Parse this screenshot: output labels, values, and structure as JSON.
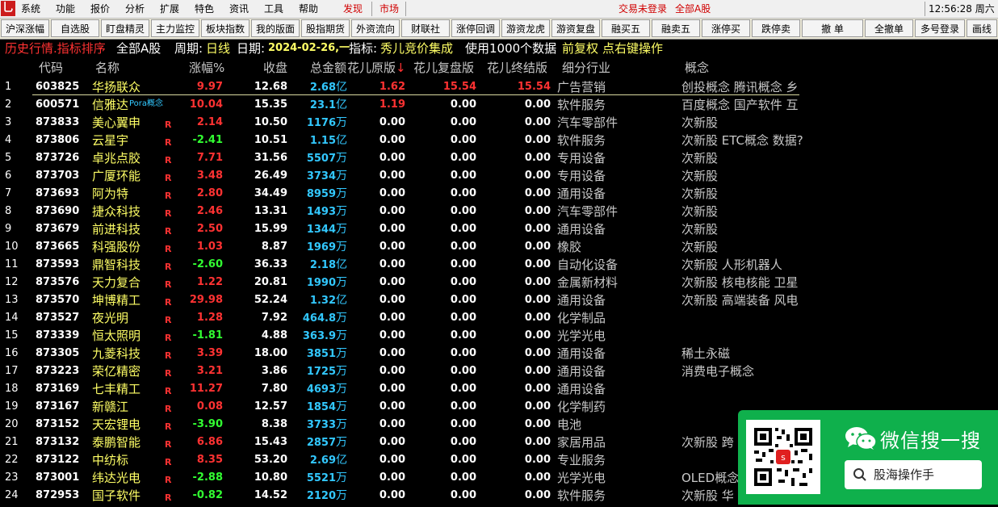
{
  "menu": {
    "items": [
      "系统",
      "功能",
      "报价",
      "分析",
      "扩展",
      "特色",
      "资讯",
      "工具",
      "帮助"
    ],
    "discover": "发现",
    "market": "市场",
    "login_status": "交易未登录",
    "market_scope": "全部A股",
    "clock": "12:56:28 周六"
  },
  "toolbar": {
    "buttons": [
      "沪深涨幅",
      "自选股",
      "盯盘精灵",
      "主力监控",
      "板块指数",
      "我的版面",
      "股指期货",
      "外资流向",
      "财联社",
      "涨停回调",
      "游资龙虎",
      "游资复盘",
      "融买五",
      "融卖五",
      "涨停买",
      "跌停卖",
      "撤 单",
      "全撤单",
      "多号登录",
      "画线"
    ]
  },
  "info": {
    "history": "历史行情.指标排序",
    "scope": "全部A股",
    "period_label": "周期:",
    "period_value": "日线",
    "date_label": "日期:",
    "date_value": "2024-02-26,一",
    "indicator_label": "指标:",
    "indicator_value": "秀儿竞价集成",
    "usage": "使用1000个数据",
    "adjust": "前复权",
    "hint": "点右键操作"
  },
  "columns": {
    "code": "代码",
    "name": "名称",
    "change_pct": "涨幅%",
    "close": "收盘",
    "amount": "总金额",
    "orig": "花儿原版",
    "sort_arrow": "↓",
    "fupan": "花儿复盘版",
    "final": "花儿终结版",
    "industry": "细分行业",
    "concept": "概念"
  },
  "tooltip": "Pora概念",
  "rows": [
    {
      "idx": "1",
      "code": "603825",
      "name": "华扬联众",
      "r": "",
      "pct": "9.97",
      "dir": "up",
      "close": "12.68",
      "amt": "2.68",
      "unit": "亿",
      "orig": "1.62",
      "orig_red": true,
      "fupan": "15.54",
      "fupan_red": true,
      "final": "15.54",
      "final_red": true,
      "industry": "广告营销",
      "concept": "创投概念 腾讯概念 乡"
    },
    {
      "idx": "2",
      "code": "600571",
      "name": "信雅达",
      "r": "",
      "pct": "10.04",
      "dir": "up",
      "close": "15.35",
      "amt": "23.1",
      "unit": "亿",
      "orig": "1.19",
      "orig_red": true,
      "fupan": "0.00",
      "fupan_red": false,
      "final": "0.00",
      "final_red": false,
      "industry": "软件服务",
      "concept": "百度概念 国产软件 互"
    },
    {
      "idx": "3",
      "code": "873833",
      "name": "美心翼申",
      "r": "R",
      "pct": "2.14",
      "dir": "up",
      "close": "10.50",
      "amt": "1176",
      "unit": "万",
      "orig": "0.00",
      "orig_red": false,
      "fupan": "0.00",
      "fupan_red": false,
      "final": "0.00",
      "final_red": false,
      "industry": "汽车零部件",
      "concept": "次新股"
    },
    {
      "idx": "4",
      "code": "873806",
      "name": "云星宇",
      "r": "R",
      "pct": "-2.41",
      "dir": "down",
      "close": "10.51",
      "amt": "1.15",
      "unit": "亿",
      "orig": "0.00",
      "orig_red": false,
      "fupan": "0.00",
      "fupan_red": false,
      "final": "0.00",
      "final_red": false,
      "industry": "软件服务",
      "concept": "次新股 ETC概念 数据?"
    },
    {
      "idx": "5",
      "code": "873726",
      "name": "卓兆点胶",
      "r": "R",
      "pct": "7.71",
      "dir": "up",
      "close": "31.56",
      "amt": "5507",
      "unit": "万",
      "orig": "0.00",
      "orig_red": false,
      "fupan": "0.00",
      "fupan_red": false,
      "final": "0.00",
      "final_red": false,
      "industry": "专用设备",
      "concept": "次新股"
    },
    {
      "idx": "6",
      "code": "873703",
      "name": "广厦环能",
      "r": "R",
      "pct": "3.48",
      "dir": "up",
      "close": "26.49",
      "amt": "3734",
      "unit": "万",
      "orig": "0.00",
      "orig_red": false,
      "fupan": "0.00",
      "fupan_red": false,
      "final": "0.00",
      "final_red": false,
      "industry": "专用设备",
      "concept": "次新股"
    },
    {
      "idx": "7",
      "code": "873693",
      "name": "阿为特",
      "r": "R",
      "pct": "2.80",
      "dir": "up",
      "close": "34.49",
      "amt": "8959",
      "unit": "万",
      "orig": "0.00",
      "orig_red": false,
      "fupan": "0.00",
      "fupan_red": false,
      "final": "0.00",
      "final_red": false,
      "industry": "通用设备",
      "concept": "次新股"
    },
    {
      "idx": "8",
      "code": "873690",
      "name": "捷众科技",
      "r": "R",
      "pct": "2.46",
      "dir": "up",
      "close": "13.31",
      "amt": "1493",
      "unit": "万",
      "orig": "0.00",
      "orig_red": false,
      "fupan": "0.00",
      "fupan_red": false,
      "final": "0.00",
      "final_red": false,
      "industry": "汽车零部件",
      "concept": "次新股"
    },
    {
      "idx": "9",
      "code": "873679",
      "name": "前进科技",
      "r": "R",
      "pct": "2.50",
      "dir": "up",
      "close": "15.99",
      "amt": "1344",
      "unit": "万",
      "orig": "0.00",
      "orig_red": false,
      "fupan": "0.00",
      "fupan_red": false,
      "final": "0.00",
      "final_red": false,
      "industry": "通用设备",
      "concept": "次新股"
    },
    {
      "idx": "10",
      "code": "873665",
      "name": "科强股份",
      "r": "R",
      "pct": "1.03",
      "dir": "up",
      "close": "8.87",
      "amt": "1969",
      "unit": "万",
      "orig": "0.00",
      "orig_red": false,
      "fupan": "0.00",
      "fupan_red": false,
      "final": "0.00",
      "final_red": false,
      "industry": "橡胶",
      "concept": "次新股"
    },
    {
      "idx": "11",
      "code": "873593",
      "name": "鼎智科技",
      "r": "R",
      "pct": "-2.60",
      "dir": "down",
      "close": "36.33",
      "amt": "2.18",
      "unit": "亿",
      "orig": "0.00",
      "orig_red": false,
      "fupan": "0.00",
      "fupan_red": false,
      "final": "0.00",
      "final_red": false,
      "industry": "自动化设备",
      "concept": "次新股 人形机器人"
    },
    {
      "idx": "12",
      "code": "873576",
      "name": "天力复合",
      "r": "R",
      "pct": "1.22",
      "dir": "up",
      "close": "20.81",
      "amt": "1990",
      "unit": "万",
      "orig": "0.00",
      "orig_red": false,
      "fupan": "0.00",
      "fupan_red": false,
      "final": "0.00",
      "final_red": false,
      "industry": "金属新材料",
      "concept": "次新股 核电核能 卫星"
    },
    {
      "idx": "13",
      "code": "873570",
      "name": "坤博精工",
      "r": "R",
      "pct": "29.98",
      "dir": "up",
      "close": "52.24",
      "amt": "1.32",
      "unit": "亿",
      "orig": "0.00",
      "orig_red": false,
      "fupan": "0.00",
      "fupan_red": false,
      "final": "0.00",
      "final_red": false,
      "industry": "通用设备",
      "concept": "次新股 高端装备 风电"
    },
    {
      "idx": "14",
      "code": "873527",
      "name": "夜光明",
      "r": "R",
      "pct": "1.28",
      "dir": "up",
      "close": "7.92",
      "amt": "464.8",
      "unit": "万",
      "orig": "0.00",
      "orig_red": false,
      "fupan": "0.00",
      "fupan_red": false,
      "final": "0.00",
      "final_red": false,
      "industry": "化学制品",
      "concept": ""
    },
    {
      "idx": "15",
      "code": "873339",
      "name": "恒太照明",
      "r": "R",
      "pct": "-1.81",
      "dir": "down",
      "close": "4.88",
      "amt": "363.9",
      "unit": "万",
      "orig": "0.00",
      "orig_red": false,
      "fupan": "0.00",
      "fupan_red": false,
      "final": "0.00",
      "final_red": false,
      "industry": "光学光电",
      "concept": ""
    },
    {
      "idx": "16",
      "code": "873305",
      "name": "九菱科技",
      "r": "R",
      "pct": "3.39",
      "dir": "up",
      "close": "18.00",
      "amt": "3851",
      "unit": "万",
      "orig": "0.00",
      "orig_red": false,
      "fupan": "0.00",
      "fupan_red": false,
      "final": "0.00",
      "final_red": false,
      "industry": "通用设备",
      "concept": "稀土永磁"
    },
    {
      "idx": "17",
      "code": "873223",
      "name": "荣亿精密",
      "r": "R",
      "pct": "3.21",
      "dir": "up",
      "close": "3.86",
      "amt": "1725",
      "unit": "万",
      "orig": "0.00",
      "orig_red": false,
      "fupan": "0.00",
      "fupan_red": false,
      "final": "0.00",
      "final_red": false,
      "industry": "通用设备",
      "concept": "消费电子概念"
    },
    {
      "idx": "18",
      "code": "873169",
      "name": "七丰精工",
      "r": "R",
      "pct": "11.27",
      "dir": "up",
      "close": "7.80",
      "amt": "4693",
      "unit": "万",
      "orig": "0.00",
      "orig_red": false,
      "fupan": "0.00",
      "fupan_red": false,
      "final": "0.00",
      "final_red": false,
      "industry": "通用设备",
      "concept": ""
    },
    {
      "idx": "19",
      "code": "873167",
      "name": "新赣江",
      "r": "R",
      "pct": "0.08",
      "dir": "up",
      "close": "12.57",
      "amt": "1854",
      "unit": "万",
      "orig": "0.00",
      "orig_red": false,
      "fupan": "0.00",
      "fupan_red": false,
      "final": "0.00",
      "final_red": false,
      "industry": "化学制药",
      "concept": ""
    },
    {
      "idx": "20",
      "code": "873152",
      "name": "天宏锂电",
      "r": "R",
      "pct": "-3.90",
      "dir": "down",
      "close": "8.38",
      "amt": "3733",
      "unit": "万",
      "orig": "0.00",
      "orig_red": false,
      "fupan": "0.00",
      "fupan_red": false,
      "final": "0.00",
      "final_red": false,
      "industry": "电池",
      "concept": ""
    },
    {
      "idx": "21",
      "code": "873132",
      "name": "泰鹏智能",
      "r": "R",
      "pct": "6.86",
      "dir": "up",
      "close": "15.43",
      "amt": "2857",
      "unit": "万",
      "orig": "0.00",
      "orig_red": false,
      "fupan": "0.00",
      "fupan_red": false,
      "final": "0.00",
      "final_red": false,
      "industry": "家居用品",
      "concept": "次新股 跨"
    },
    {
      "idx": "22",
      "code": "873122",
      "name": "中纺标",
      "r": "R",
      "pct": "8.35",
      "dir": "up",
      "close": "53.20",
      "amt": "2.69",
      "unit": "亿",
      "orig": "0.00",
      "orig_red": false,
      "fupan": "0.00",
      "fupan_red": false,
      "final": "0.00",
      "final_red": false,
      "industry": "专业服务",
      "concept": ""
    },
    {
      "idx": "23",
      "code": "873001",
      "name": "纬达光电",
      "r": "R",
      "pct": "-2.88",
      "dir": "down",
      "close": "10.80",
      "amt": "5521",
      "unit": "万",
      "orig": "0.00",
      "orig_red": false,
      "fupan": "0.00",
      "fupan_red": false,
      "final": "0.00",
      "final_red": false,
      "industry": "光学光电",
      "concept": "OLED概念"
    },
    {
      "idx": "24",
      "code": "872953",
      "name": "国子软件",
      "r": "R",
      "pct": "-0.82",
      "dir": "down",
      "close": "14.52",
      "amt": "2120",
      "unit": "万",
      "orig": "0.00",
      "orig_red": false,
      "fupan": "0.00",
      "fupan_red": false,
      "final": "0.00",
      "final_red": false,
      "industry": "软件服务",
      "concept": "次新股 华"
    }
  ],
  "wechat": {
    "title": "微信搜一搜",
    "search_text": "股海操作手",
    "qr_badge": "s"
  }
}
